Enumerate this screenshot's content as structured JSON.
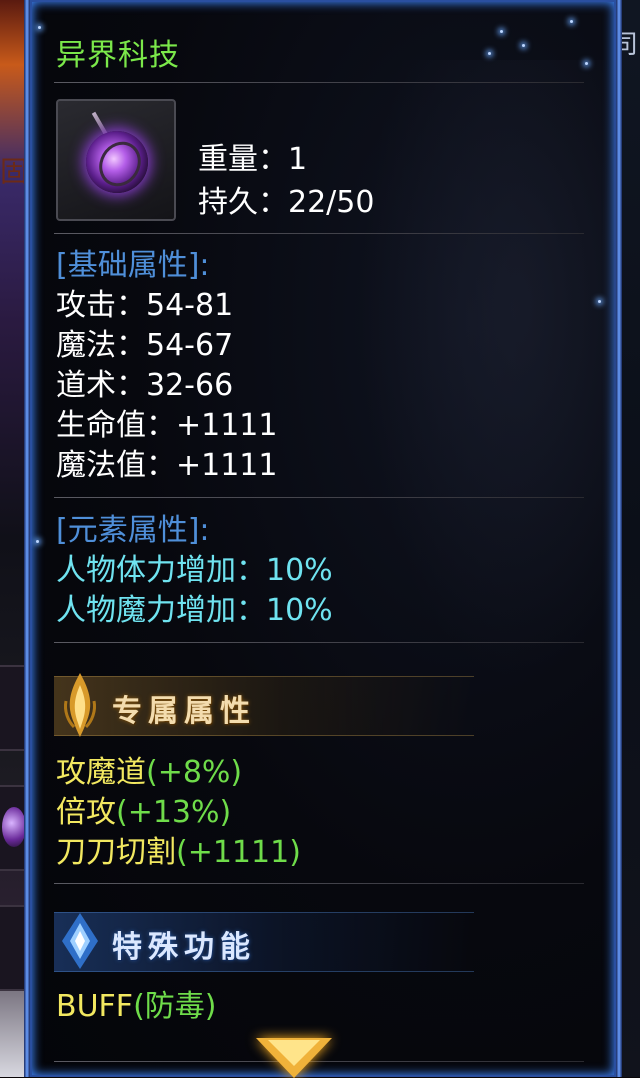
{
  "item": {
    "name": "异界科技",
    "icon": "purple-orb-amulet-icon",
    "weight_label": "重量：",
    "weight_value": "1",
    "durability_label": "持久：",
    "durability_value": "22/50"
  },
  "basic_attributes": {
    "heading": "[基础属性]:",
    "rows": [
      {
        "label": "攻击：",
        "value": "54-81"
      },
      {
        "label": "魔法：",
        "value": "54-67"
      },
      {
        "label": "道术：",
        "value": "32-66"
      },
      {
        "label": "生命值：",
        "value": "+1111"
      },
      {
        "label": "魔法值：",
        "value": "+1111"
      }
    ]
  },
  "element_attributes": {
    "heading": "[元素属性]:",
    "rows": [
      {
        "label": "人物体力增加：",
        "value": "10%"
      },
      {
        "label": "人物魔力增加：",
        "value": "10%"
      }
    ]
  },
  "exclusive_attributes": {
    "banner": "专属属性",
    "icon": "golden-flame-emblem-icon",
    "rows": [
      {
        "name": "攻魔道",
        "bonus": "(+8%)"
      },
      {
        "name": "倍攻",
        "bonus": "(+13%)"
      },
      {
        "name": "刀刀切割",
        "bonus": "(+1111)"
      }
    ]
  },
  "special_functions": {
    "banner": "特殊功能",
    "icon": "blue-crystal-emblem-icon",
    "rows": [
      {
        "name": "BUFF",
        "bonus": "(防毒)"
      }
    ]
  },
  "scroll_indicator": "down-arrow-icon",
  "colors": {
    "title": "#7be84a",
    "heading": "#4f8fd9",
    "element_text": "#6fe3f0",
    "exclusive_name": "#f2e860",
    "bonus": "#6fdc4a",
    "panel_border": "#3a7ff0"
  }
}
